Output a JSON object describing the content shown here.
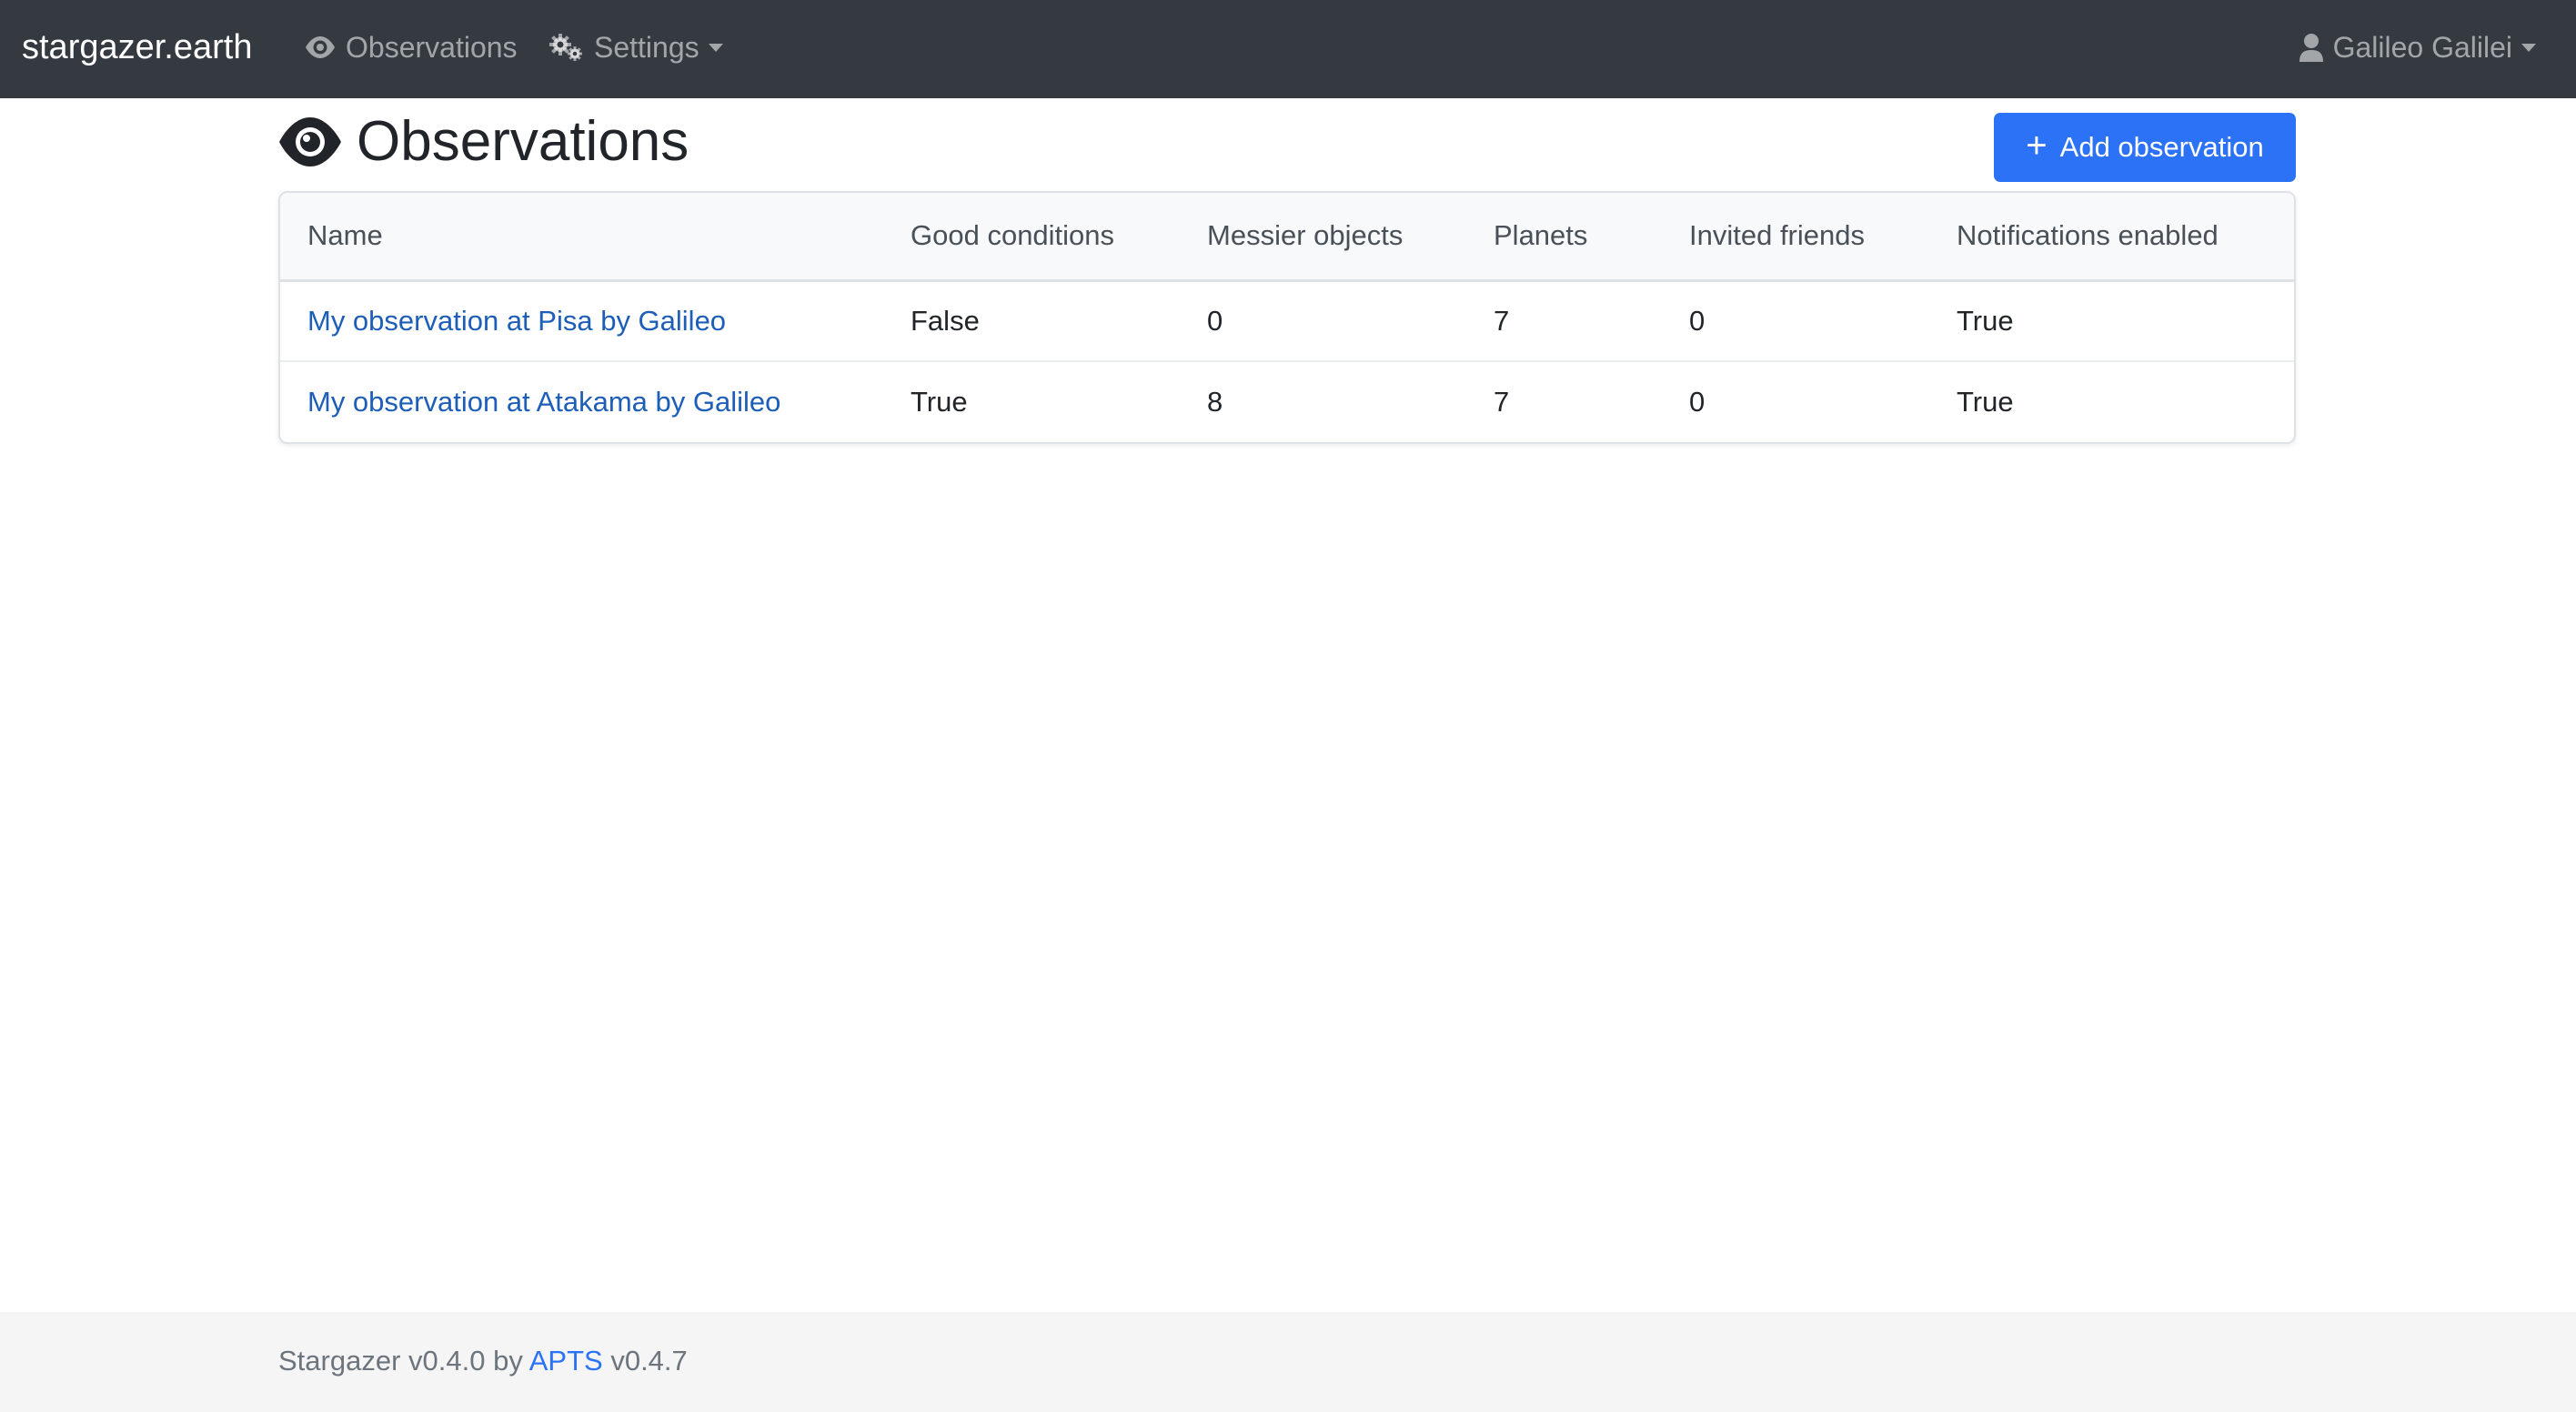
{
  "navbar": {
    "brand": "stargazer.earth",
    "observations_label": "Observations",
    "settings_label": "Settings",
    "user_label": "Galileo Galilei"
  },
  "header": {
    "title": "Observations",
    "add_button_label": "Add observation"
  },
  "table": {
    "columns": [
      "Name",
      "Good conditions",
      "Messier objects",
      "Planets",
      "Invited friends",
      "Notifications enabled"
    ],
    "rows": [
      [
        "My observation at Pisa by Galileo",
        "False",
        "0",
        "7",
        "0",
        "True"
      ],
      [
        "My observation at Atakama by Galileo",
        "True",
        "8",
        "7",
        "0",
        "True"
      ]
    ]
  },
  "footer": {
    "prefix": "Stargazer v0.4.0 by",
    "link": "APTS",
    "suffix": "v0.4.7"
  },
  "colors": {
    "navbar_bg": "#343a40",
    "primary": "#2b72f6",
    "link": "#1d5eb8"
  },
  "icons": {
    "observations": "eye-icon",
    "settings": "gears-icon",
    "user": "user-icon",
    "add": "plus-icon"
  }
}
